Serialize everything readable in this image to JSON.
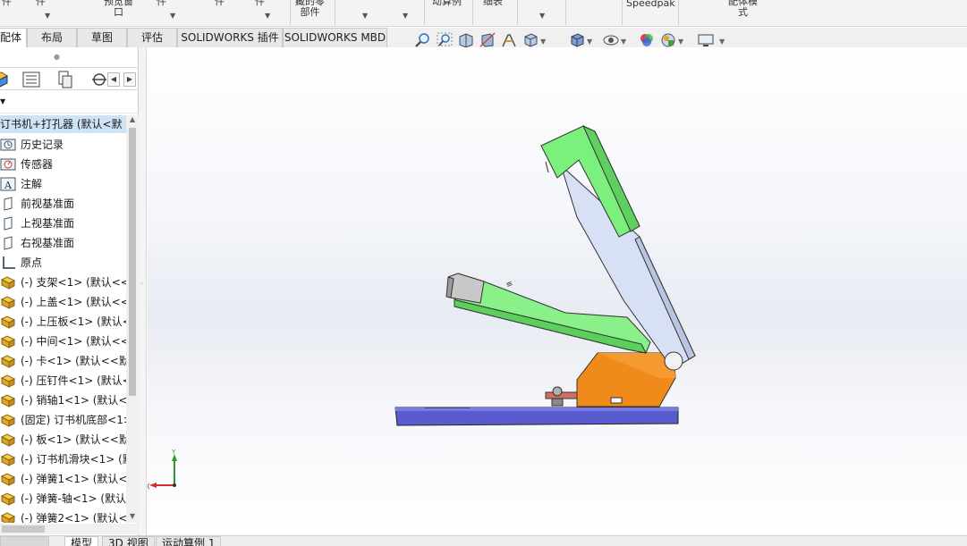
{
  "ribbon": {
    "items": [
      "件",
      "预览窗口",
      "件",
      "件",
      "件",
      "藏的零部件",
      "",
      "",
      "动算例",
      "细表",
      "",
      "Speedpak",
      "配体模式"
    ],
    "speedpak": "Speedpak",
    "preview": "预览窗\n口",
    "hidden_parts": "藏的零\n部件",
    "motion": "动算例",
    "bom": "细表",
    "assembly_mode": "配体模\n式"
  },
  "tabs": [
    "配体",
    "布局",
    "草图",
    "评估",
    "SOLIDWORKS 插件",
    "SOLIDWORKS MBD"
  ],
  "tree": {
    "root": "订书机+打孔器 (默认<默",
    "items": [
      {
        "label": "历史记录",
        "icon": "history-icon"
      },
      {
        "label": "传感器",
        "icon": "sensor-icon"
      },
      {
        "label": "注解",
        "icon": "annotation-icon"
      },
      {
        "label": "前视基准面",
        "icon": "plane-icon"
      },
      {
        "label": "上视基准面",
        "icon": "plane-icon"
      },
      {
        "label": "右视基准面",
        "icon": "plane-icon"
      },
      {
        "label": "原点",
        "icon": "origin-icon"
      },
      {
        "label": "(-) 支架<1> (默认<<",
        "icon": "part-icon"
      },
      {
        "label": "(-) 上盖<1> (默认<<",
        "icon": "part-icon"
      },
      {
        "label": "(-) 上压板<1> (默认<",
        "icon": "part-icon"
      },
      {
        "label": "(-) 中间<1> (默认<<",
        "icon": "part-icon"
      },
      {
        "label": "(-) 卡<1> (默认<<默",
        "icon": "part-icon"
      },
      {
        "label": "(-) 压钉件<1> (默认<",
        "icon": "part-icon"
      },
      {
        "label": "(-) 销轴1<1> (默认<",
        "icon": "part-icon"
      },
      {
        "label": "(固定) 订书机底部<1>",
        "icon": "part-icon"
      },
      {
        "label": "(-) 板<1> (默认<<默",
        "icon": "part-icon"
      },
      {
        "label": "(-) 订书机滑块<1> (默",
        "icon": "part-icon"
      },
      {
        "label": "(-) 弹簧1<1> (默认<",
        "icon": "part-icon"
      },
      {
        "label": "(-) 弹簧-轴<1> (默认",
        "icon": "part-icon"
      },
      {
        "label": "(-) 弹簧2<1> (默认<",
        "icon": "part-icon"
      }
    ]
  },
  "triad": {
    "x": "X",
    "y": "Y"
  },
  "bottom_tabs": [
    "模型",
    "3D 视图",
    "运动算例 1"
  ],
  "colors": {
    "accent": "#cde3f6",
    "arm_green": "#7cf07c",
    "arm_blue": "#d3dcf3",
    "hinge_orange": "#f08a1a",
    "base_purple": "#5c5ccc"
  }
}
